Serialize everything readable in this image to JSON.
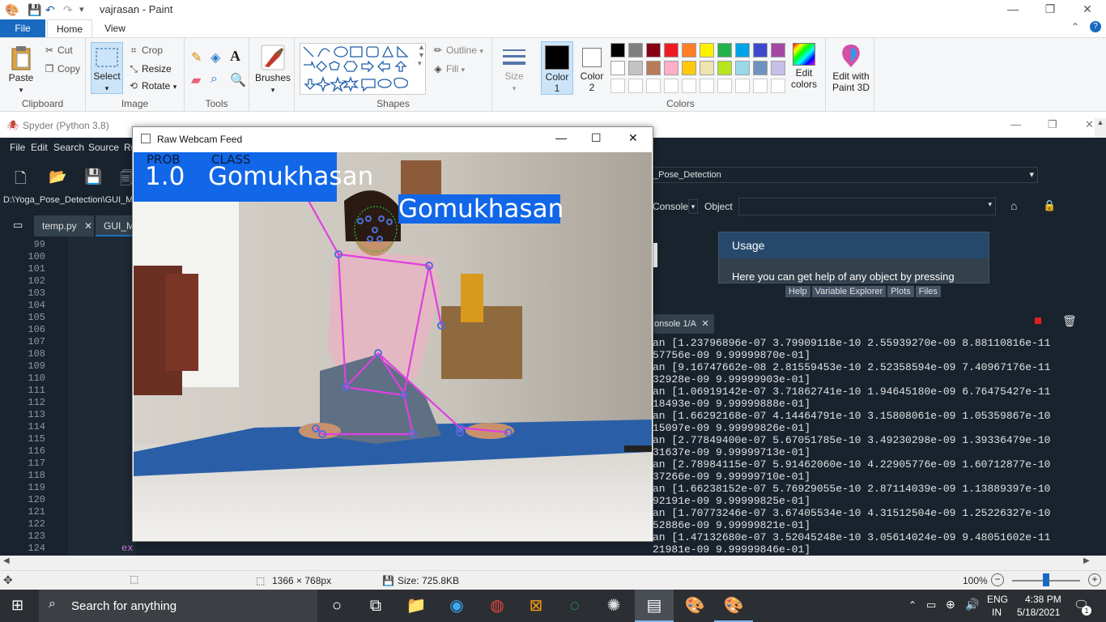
{
  "paint": {
    "doc_name": "vajrasan",
    "app_name": "Paint",
    "title": "vajrasan - Paint",
    "tabs": [
      "File",
      "Home",
      "View"
    ],
    "clipboard": {
      "paste": "Paste",
      "cut": "Cut",
      "copy": "Copy",
      "group": "Clipboard"
    },
    "image": {
      "select": "Select",
      "crop": "Crop",
      "resize": "Resize",
      "rotate": "Rotate",
      "group": "Image"
    },
    "tools": {
      "group": "Tools"
    },
    "brushes": "Brushes",
    "shapes": {
      "outline": "Outline",
      "fill": "Fill",
      "group": "Shapes"
    },
    "size": "Size",
    "color1": {
      "label": "Color",
      "num": "1"
    },
    "color2": {
      "label": "Color",
      "num": "2"
    },
    "edit_colors": {
      "line1": "Edit",
      "line2": "colors"
    },
    "colors_group": "Colors",
    "edit_paint3d": {
      "line1": "Edit with",
      "line2": "Paint 3D"
    },
    "palette_row1": [
      "#000000",
      "#7f7f7f",
      "#880015",
      "#ed1c24",
      "#ff7f27",
      "#fff200",
      "#22b14c",
      "#00a2e8",
      "#3f48cc",
      "#a349a4"
    ],
    "palette_row2": [
      "#ffffff",
      "#c3c3c3",
      "#b97a57",
      "#ffaec9",
      "#ffc90e",
      "#efe4b0",
      "#b5e61d",
      "#99d9ea",
      "#7092be",
      "#c8bfe7"
    ],
    "status": {
      "dimensions": "1366 × 768px",
      "size": "Size: 725.8KB",
      "zoom": "100%"
    }
  },
  "spyder": {
    "title": "Spyder (Python 3.8)",
    "menu": [
      "File",
      "Edit",
      "Search",
      "Source",
      "Ru"
    ],
    "path": "D:\\Yoga_Pose_Detection\\GUI_M",
    "editor_tabs": [
      "temp.py",
      "GUI_Ma"
    ],
    "line_numbers": [
      "99",
      "100",
      "101",
      "102",
      "103",
      "104",
      "105",
      "106",
      "107",
      "108",
      "109",
      "110",
      "111",
      "112",
      "113",
      "114",
      "115",
      "116",
      "117",
      "118",
      "119",
      "120",
      "121",
      "122",
      "123",
      "124"
    ],
    "code_fragment": "ex",
    "project_combo": "_Pose_Detection",
    "console_label": "Console",
    "object_label": "Object",
    "usage_title": "Usage",
    "usage_text": "Here you can get help of any object by pressing",
    "pane_tabs": [
      "Help",
      "Variable Explorer",
      "Plots",
      "Files"
    ],
    "console_tab": "onsole 1/A",
    "console_lines": [
      "an [1.23796896e-07 3.79909118e-10 2.55939270e-09 8.88110816e-11",
      "57756e-09 9.99999870e-01]",
      "an [9.16747662e-08 2.81559453e-10 2.52358594e-09 7.40967176e-11",
      "32928e-09 9.99999903e-01]",
      "an [1.06919142e-07 3.71862741e-10 1.94645180e-09 6.76475427e-11",
      "18493e-09 9.99999888e-01]",
      "an [1.66292168e-07 4.14464791e-10 3.15808061e-09 1.05359867e-10",
      "15097e-09 9.99999826e-01]",
      "an [2.77849400e-07 5.67051785e-10 3.49230298e-09 1.39336479e-10",
      "31637e-09 9.99999713e-01]",
      "an [2.78984115e-07 5.91462060e-10 4.22905776e-09 1.60712877e-10",
      "37266e-09 9.99999710e-01]",
      "an [1.66238152e-07 5.76929055e-10 2.87114039e-09 1.13889397e-10",
      "92191e-09 9.99999825e-01]",
      "an [1.70773246e-07 3.67405534e-10 4.31512504e-09 1.25226327e-10",
      "52886e-09 9.99999821e-01]",
      "an [1.47132680e-07 3.52045248e-10 3.05614024e-09 9.48051602e-11",
      "21981e-09 9.99999846e-01]"
    ]
  },
  "webcam": {
    "title": "Raw Webcam Feed",
    "prob_label": "PROB",
    "class_label": "CLASS",
    "prob_value": "1.0",
    "class_value": "Gomukhasan",
    "head_label": "Gomukhasan"
  },
  "taskbar": {
    "search_placeholder": "Search for anything",
    "lang_top": "ENG",
    "lang_bottom": "IN",
    "time": "4:38 PM",
    "date": "5/18/2021",
    "notif_count": "1"
  }
}
